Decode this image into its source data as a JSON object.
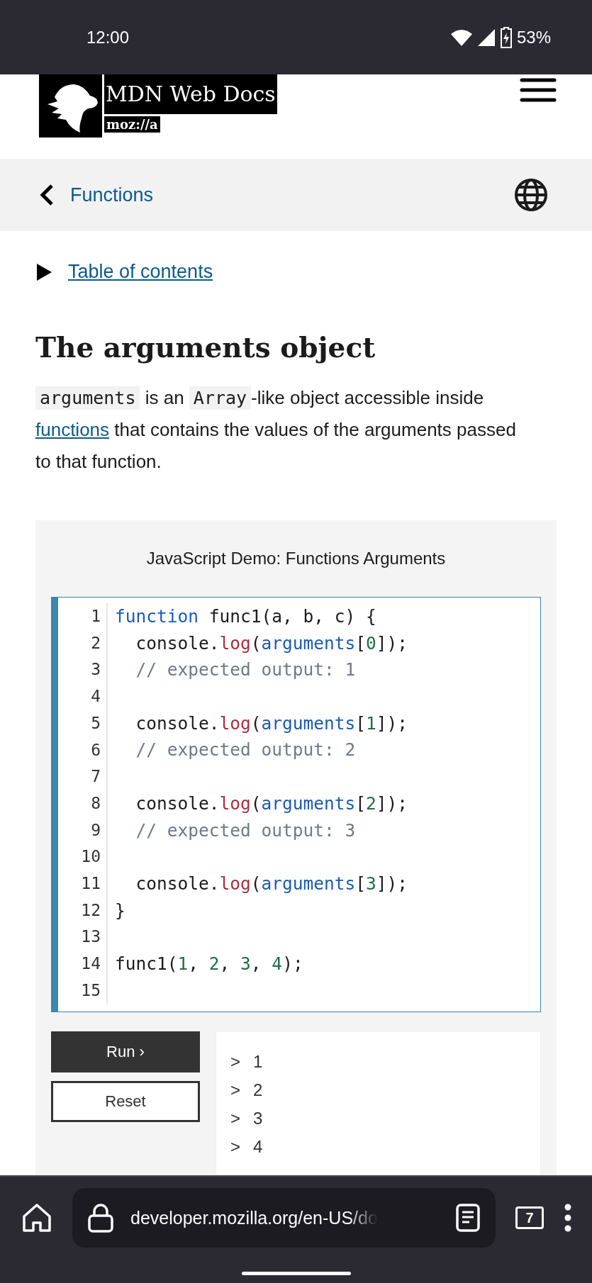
{
  "status_bar": {
    "time": "12:00",
    "battery": "53%"
  },
  "header": {
    "logo_title": "MDN Web Docs",
    "logo_subtitle": "moz://a"
  },
  "breadcrumb": {
    "label": "Functions"
  },
  "toc": {
    "label": "Table of contents",
    "expanded": false
  },
  "article": {
    "heading": "The arguments object",
    "paragraph": [
      {
        "kind": "code",
        "text": "arguments"
      },
      {
        "kind": "text",
        "text": " is an "
      },
      {
        "kind": "code",
        "text": "Array"
      },
      {
        "kind": "text",
        "text": "-like object accessible inside "
      },
      {
        "kind": "link",
        "text": "functions"
      },
      {
        "kind": "text",
        "text": " that contains the values of the arguments passed to that function."
      }
    ]
  },
  "demo": {
    "title": "JavaScript Demo: Functions Arguments",
    "lines": [
      {
        "number": "1",
        "tokens": [
          {
            "kind": "keyword",
            "text": "function"
          },
          {
            "kind": "plain",
            "text": " func1(a, b, c) {"
          }
        ]
      },
      {
        "number": "2",
        "tokens": [
          {
            "kind": "plain",
            "text": "  console."
          },
          {
            "kind": "method",
            "text": "log"
          },
          {
            "kind": "plain",
            "text": "("
          },
          {
            "kind": "keyword",
            "text": "arguments"
          },
          {
            "kind": "plain",
            "text": "["
          },
          {
            "kind": "number",
            "text": "0"
          },
          {
            "kind": "plain",
            "text": "]);"
          }
        ]
      },
      {
        "number": "3",
        "tokens": [
          {
            "kind": "comment",
            "text": "  // expected output: 1"
          }
        ]
      },
      {
        "number": "4"
      },
      {
        "number": "5",
        "tokens": [
          {
            "kind": "plain",
            "text": "  console."
          },
          {
            "kind": "method",
            "text": "log"
          },
          {
            "kind": "plain",
            "text": "("
          },
          {
            "kind": "keyword",
            "text": "arguments"
          },
          {
            "kind": "plain",
            "text": "["
          },
          {
            "kind": "number",
            "text": "1"
          },
          {
            "kind": "plain",
            "text": "]);"
          }
        ]
      },
      {
        "number": "6",
        "tokens": [
          {
            "kind": "comment",
            "text": "  // expected output: 2"
          }
        ]
      },
      {
        "number": "7"
      },
      {
        "number": "8",
        "tokens": [
          {
            "kind": "plain",
            "text": "  console."
          },
          {
            "kind": "method",
            "text": "log"
          },
          {
            "kind": "plain",
            "text": "("
          },
          {
            "kind": "keyword",
            "text": "arguments"
          },
          {
            "kind": "plain",
            "text": "["
          },
          {
            "kind": "number",
            "text": "2"
          },
          {
            "kind": "plain",
            "text": "]);"
          }
        ]
      },
      {
        "number": "9",
        "tokens": [
          {
            "kind": "comment",
            "text": "  // expected output: 3"
          }
        ]
      },
      {
        "number": "10"
      },
      {
        "number": "11",
        "tokens": [
          {
            "kind": "plain",
            "text": "  console."
          },
          {
            "kind": "method",
            "text": "log"
          },
          {
            "kind": "plain",
            "text": "("
          },
          {
            "kind": "keyword",
            "text": "arguments"
          },
          {
            "kind": "plain",
            "text": "["
          },
          {
            "kind": "number",
            "text": "3"
          },
          {
            "kind": "plain",
            "text": "]);"
          }
        ]
      },
      {
        "number": "12",
        "tokens": [
          {
            "kind": "plain",
            "text": "}"
          }
        ]
      },
      {
        "number": "13"
      },
      {
        "number": "14",
        "tokens": [
          {
            "kind": "plain",
            "text": "func1("
          },
          {
            "kind": "number",
            "text": "1"
          },
          {
            "kind": "plain",
            "text": ", "
          },
          {
            "kind": "number",
            "text": "2"
          },
          {
            "kind": "plain",
            "text": ", "
          },
          {
            "kind": "number",
            "text": "3"
          },
          {
            "kind": "plain",
            "text": ", "
          },
          {
            "kind": "number",
            "text": "4"
          },
          {
            "kind": "plain",
            "text": ");"
          }
        ]
      },
      {
        "number": "15"
      }
    ],
    "buttons": [
      {
        "kind": "primary",
        "label": "Run ›"
      },
      {
        "kind": "secondary",
        "label": "Reset"
      }
    ],
    "output": [
      {
        "prompt": ">",
        "value": "1"
      },
      {
        "prompt": ">",
        "value": "2"
      },
      {
        "prompt": ">",
        "value": "3"
      },
      {
        "prompt": ">",
        "value": "4"
      }
    ]
  },
  "browser_bar": {
    "url": "developer.mozilla.org/en-US/do",
    "tab_count": "7"
  }
}
